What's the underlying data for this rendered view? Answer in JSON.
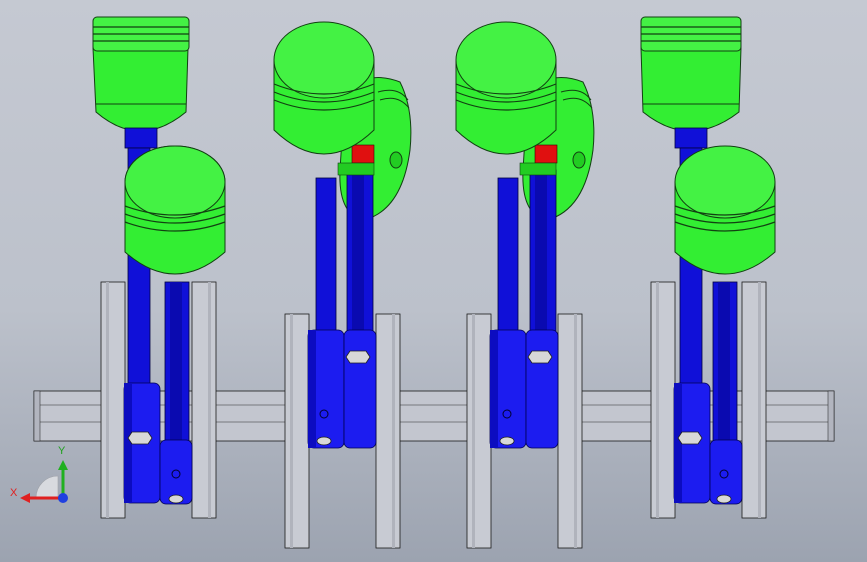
{
  "viewport": {
    "background_top": "#c5c9d2",
    "background_bottom": "#9ca3b0"
  },
  "model": {
    "cylinders": 8,
    "piston_color": "#33ee33",
    "rod_color": "#1010d8",
    "cap_color": "#1c1cf0",
    "crank_color": "#c4c7d0",
    "bolt_color": "#d8d8d8",
    "pin_insert_color": "#e01010"
  },
  "triad": {
    "x_label": "X",
    "y_label": "Y",
    "x_color": "#e02020",
    "y_color": "#20b020",
    "z_color": "#2040e0"
  }
}
